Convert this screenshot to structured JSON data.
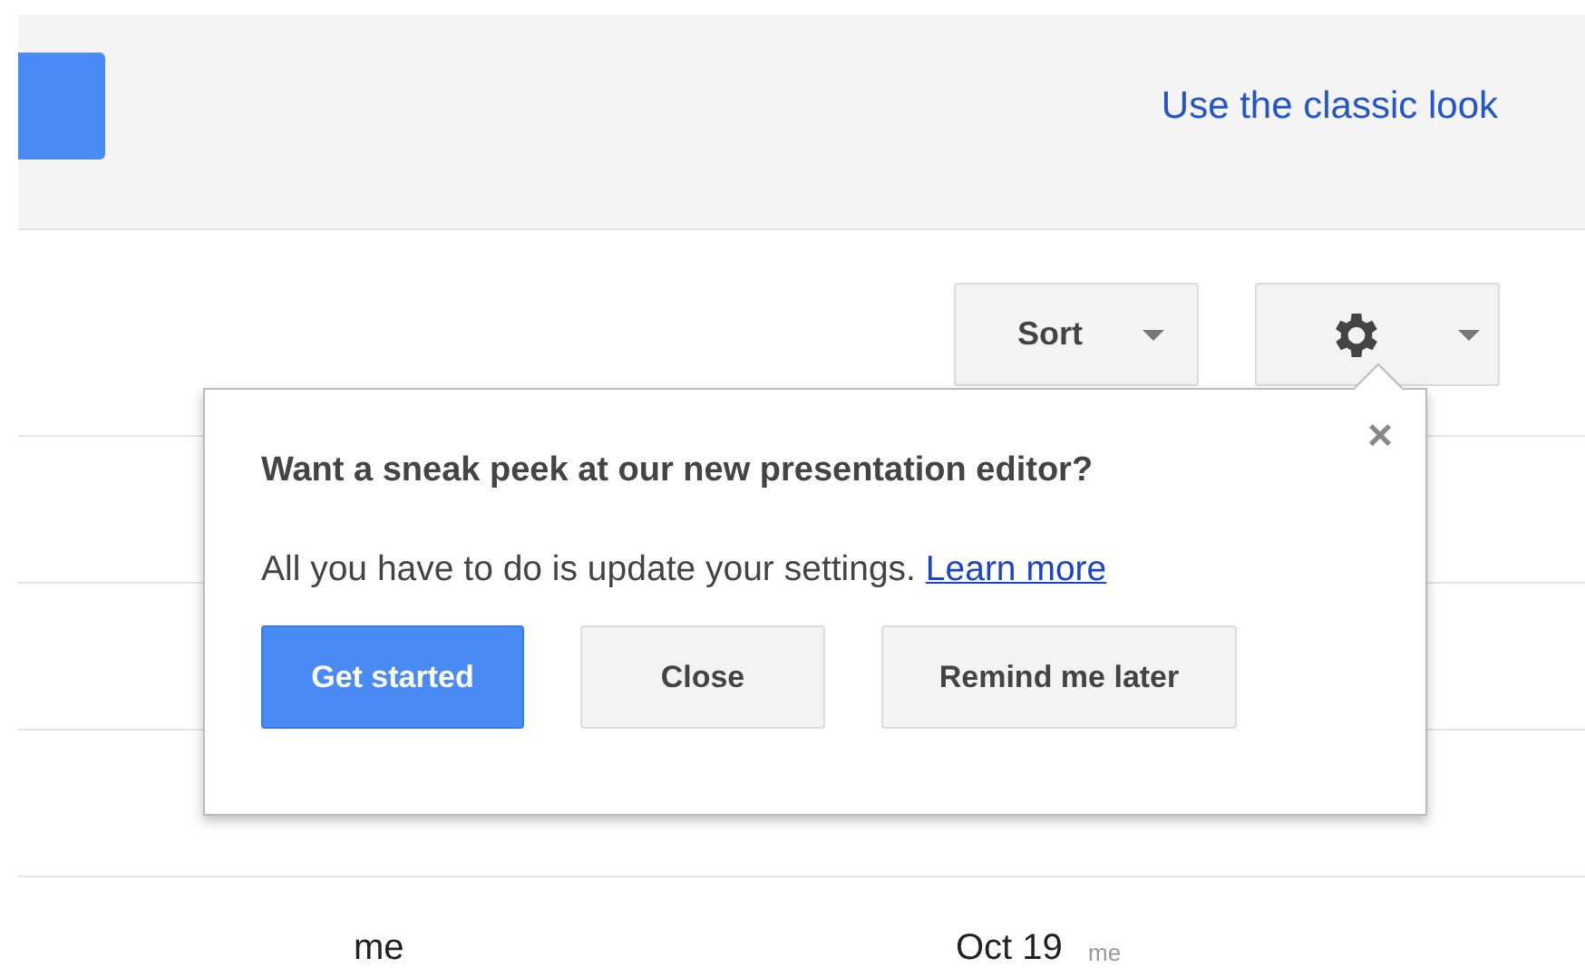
{
  "header": {
    "classic_link": "Use the classic look"
  },
  "toolbar": {
    "sort_label": "Sort"
  },
  "rows": [
    {
      "owner": "me",
      "modified": "Oct 19",
      "modified_by": "me"
    }
  ],
  "popup": {
    "title": "Want a sneak peek at our new presentation editor?",
    "close_glyph": "×",
    "body": "All you have to do is update your settings.",
    "link": "Learn more",
    "buttons": [
      {
        "label": "Get started",
        "kind": "primary"
      },
      {
        "label": "Close",
        "kind": "secondary"
      },
      {
        "label": "Remind me later",
        "kind": "secondary"
      }
    ]
  }
}
